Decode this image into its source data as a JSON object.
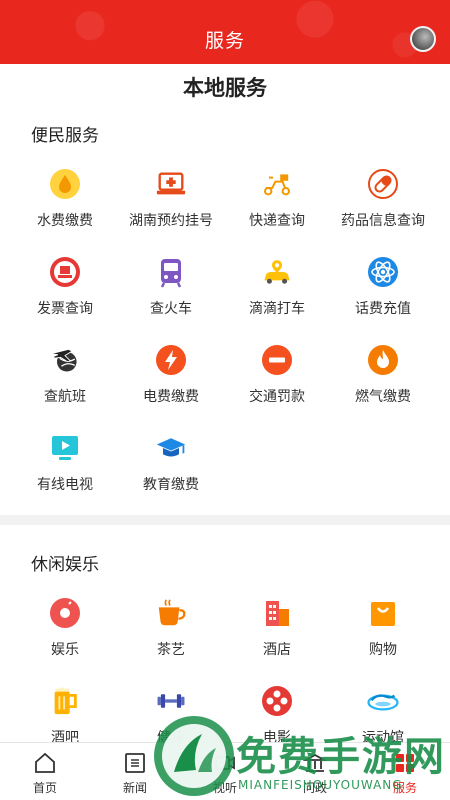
{
  "header": {
    "title": "服务"
  },
  "page_title": "本地服务",
  "sections": [
    {
      "title": "便民服务",
      "items": [
        {
          "label": "水费缴费",
          "icon": "water-drop-icon"
        },
        {
          "label": "湖南预约挂号",
          "icon": "hospital-laptop-icon"
        },
        {
          "label": "快递查询",
          "icon": "delivery-scooter-icon"
        },
        {
          "label": "药品信息查询",
          "icon": "pill-icon"
        },
        {
          "label": "发票查询",
          "icon": "invoice-seal-icon"
        },
        {
          "label": "查火车",
          "icon": "train-icon"
        },
        {
          "label": "滴滴打车",
          "icon": "car-icon"
        },
        {
          "label": "话费充值",
          "icon": "atom-icon"
        },
        {
          "label": "查航班",
          "icon": "airplane-globe-icon"
        },
        {
          "label": "电费缴费",
          "icon": "lightning-icon"
        },
        {
          "label": "交通罚款",
          "icon": "no-entry-icon"
        },
        {
          "label": "燃气缴费",
          "icon": "flame-icon"
        },
        {
          "label": "有线电视",
          "icon": "tv-play-icon"
        },
        {
          "label": "教育缴费",
          "icon": "graduation-cap-icon"
        }
      ]
    },
    {
      "title": "休闲娱乐",
      "items": [
        {
          "label": "娱乐",
          "icon": "music-disc-icon"
        },
        {
          "label": "茶艺",
          "icon": "tea-cup-icon"
        },
        {
          "label": "酒店",
          "icon": "hotel-building-icon"
        },
        {
          "label": "购物",
          "icon": "shopping-bag-icon"
        },
        {
          "label": "酒吧",
          "icon": "beer-mug-icon"
        },
        {
          "label": "健身",
          "icon": "dumbbell-icon"
        },
        {
          "label": "电影",
          "icon": "film-reel-icon"
        },
        {
          "label": "运动馆",
          "icon": "wave-stadium-icon"
        }
      ]
    }
  ],
  "tabbar": [
    {
      "label": "首页",
      "icon": "home-icon"
    },
    {
      "label": "新闻",
      "icon": "news-icon"
    },
    {
      "label": "视听",
      "icon": "video-icon"
    },
    {
      "label": "问政",
      "icon": "government-icon"
    },
    {
      "label": "服务",
      "icon": "service-icon",
      "active": true
    }
  ],
  "watermark": {
    "title": "免费手游网",
    "subtitle": "MIANFEISHOUYOUWANG"
  },
  "colors": {
    "brand_red": "#e8271f",
    "watermark_green": "#1a8f4a"
  }
}
